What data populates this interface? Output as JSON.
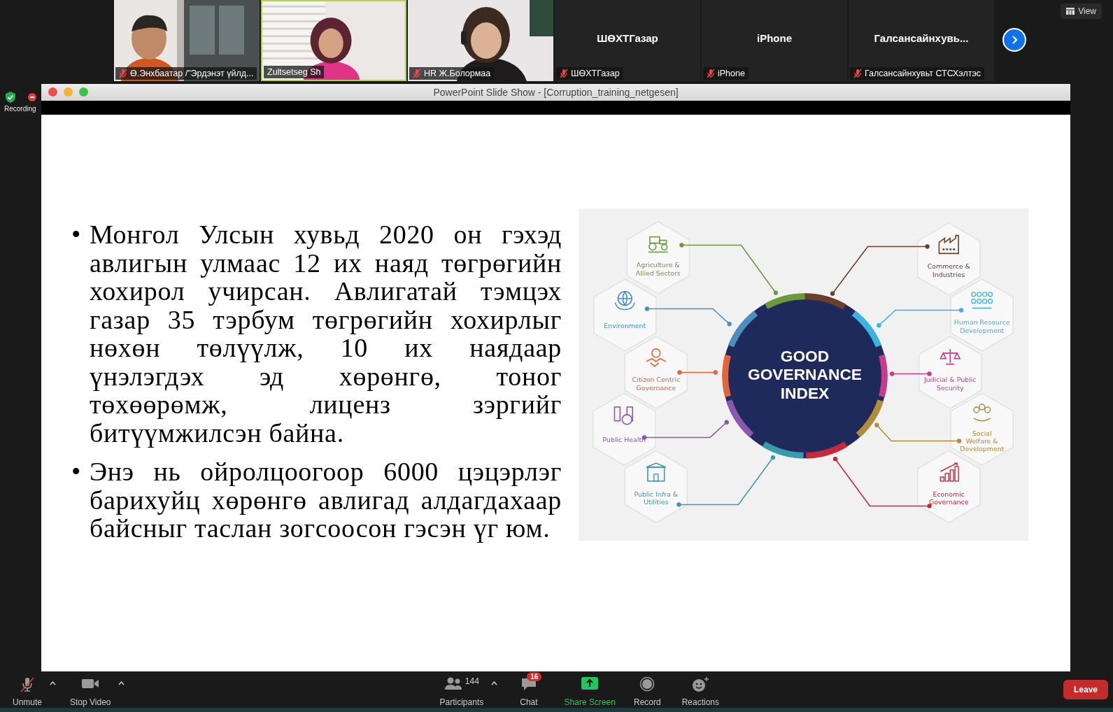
{
  "video_strip": {
    "tiles": [
      {
        "kind": "video",
        "name": "Ө.Энхбаатар /\"Эрдэнэт үйлд...",
        "muted": true,
        "active_speaker": false
      },
      {
        "kind": "video",
        "name": "Zultsetseg Sh",
        "muted": false,
        "active_speaker": true
      },
      {
        "kind": "video",
        "name": "HR Ж.Болормаа",
        "muted": true,
        "active_speaker": false
      },
      {
        "kind": "name",
        "display_name": "ШӨХТГазар",
        "name": "ШӨХТГазар",
        "muted": true,
        "active_speaker": false
      },
      {
        "kind": "name",
        "display_name": "iPhone",
        "name": "iPhone",
        "muted": true,
        "active_speaker": false
      },
      {
        "kind": "name",
        "display_name": "Галсансайнхувь...",
        "name": "Галсансайнхувьт СТСХэлтэс",
        "muted": true,
        "active_speaker": false
      }
    ],
    "view_button": "View"
  },
  "recording": {
    "label": "Recording"
  },
  "window": {
    "title": "PowerPoint Slide Show - [Corruption_training_netgesen]"
  },
  "slide": {
    "bullets": [
      {
        "marker": "•",
        "text": "Монгол Улсын хувьд 2020 он гэхэд авлигын улмаас 12 их наяд төгрөгийн хохирол учирсан. Авлигатай тэмцэх газар 35 тэрбум төгрөгийн хохирлыг нөхөн төлүүлж, 10 их наядаар үнэлэгдэх эд хөрөнгө, тоног төхөөрөмж, лиценз зэргийг битүүмжилсэн байна."
      },
      {
        "marker": "•",
        "text": "Энэ нь ойролцоогоор 6000 цэцэрлэг барихуйц хөрөнгө авлигад алдагдахаар байсныг таслан зогсоосон гэсэн үг юм."
      }
    ],
    "infographic": {
      "title": "GOOD GOVERNANCE INDEX",
      "sectors": [
        {
          "lines": [
            "Agriculture &",
            "Allied Sectors"
          ],
          "color": "#6a9a3a"
        },
        {
          "lines": [
            "Environment"
          ],
          "color": "#4a8fc0"
        },
        {
          "lines": [
            "Citizen Centric",
            "Governance"
          ],
          "color": "#e0643c"
        },
        {
          "lines": [
            "Public Health"
          ],
          "color": "#8a58b0"
        },
        {
          "lines": [
            "Public Infra &",
            "Utilities"
          ],
          "color": "#3a9ab0"
        },
        {
          "lines": [
            "Commerce &",
            "Industries"
          ],
          "color": "#6b3f2a"
        },
        {
          "lines": [
            "Human Resource",
            "Development"
          ],
          "color": "#3ab4e0"
        },
        {
          "lines": [
            "Judicial & Public",
            "Security"
          ],
          "color": "#c83c8c"
        },
        {
          "lines": [
            "Social",
            "Welfare &",
            "Development"
          ],
          "color": "#b08c3c"
        },
        {
          "lines": [
            "Economic",
            "Governance"
          ],
          "color": "#c8283c"
        }
      ]
    }
  },
  "toolbar": {
    "buttons": [
      {
        "kind": "mic",
        "label": "Unmute",
        "muted": true,
        "has_menu": true
      },
      {
        "kind": "video",
        "label": "Stop Video",
        "has_menu": true
      },
      {
        "kind": "participants",
        "label": "Participants",
        "count": "144",
        "has_menu": true
      },
      {
        "kind": "chat",
        "label": "Chat",
        "badge": "16",
        "has_menu": false
      },
      {
        "kind": "share",
        "label": "Share Screen",
        "has_menu": false
      },
      {
        "kind": "record",
        "label": "Record",
        "has_menu": false
      },
      {
        "kind": "reactions",
        "label": "Reactions",
        "has_menu": false
      },
      {
        "kind": "leave",
        "label": "Leave",
        "has_menu": false
      }
    ]
  }
}
